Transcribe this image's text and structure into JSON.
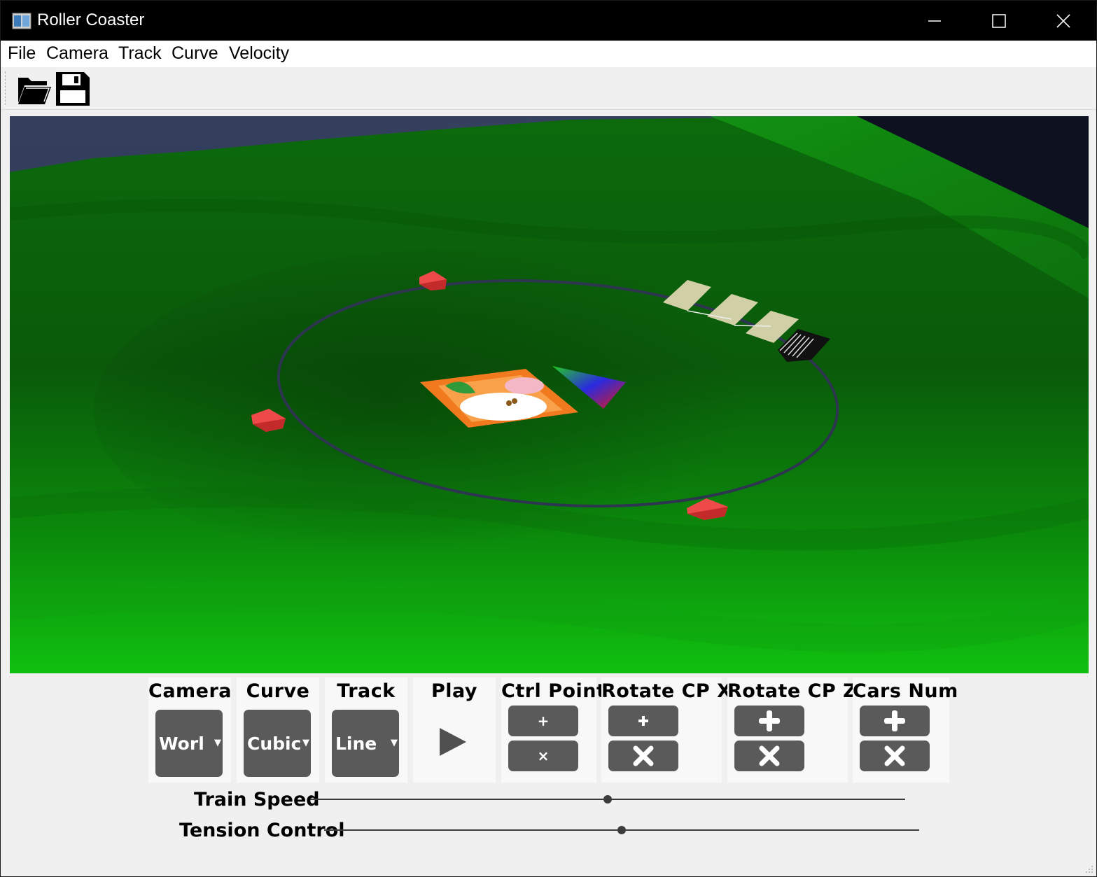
{
  "window": {
    "title": "Roller Coaster"
  },
  "menubar": {
    "items": [
      {
        "label": "File"
      },
      {
        "label": "Camera"
      },
      {
        "label": "Track"
      },
      {
        "label": "Curve"
      },
      {
        "label": "Velocity"
      }
    ]
  },
  "toolbar": {
    "tools": [
      {
        "icon": "open-folder-icon"
      },
      {
        "icon": "save-disk-icon"
      }
    ]
  },
  "controls": {
    "camera": {
      "label": "Camera",
      "value": "Worl"
    },
    "curve": {
      "label": "Curve",
      "value": "Cubic"
    },
    "track": {
      "label": "Track",
      "value": "Line"
    },
    "play": {
      "label": "Play",
      "icon": "play-icon"
    },
    "ctrl_point": {
      "label": "Ctrl Point",
      "add": "+",
      "remove": "×"
    },
    "rotate_x": {
      "label": "Rotate  CP X"
    },
    "rotate_z": {
      "label": "Rotate  CP Z"
    },
    "cars_num": {
      "label": "Cars Num"
    }
  },
  "sliders": {
    "train_speed": {
      "label": "Train Speed",
      "value": 0.5
    },
    "tension": {
      "label": "Tension Control",
      "value": 0.5
    }
  },
  "colors": {
    "titlebar": "#000000",
    "button": "#5a5a5a",
    "terrain": "#0a8a0a",
    "sky": "#2a3550",
    "track_line": "#2e3550",
    "control_point": "#e33a3a"
  }
}
